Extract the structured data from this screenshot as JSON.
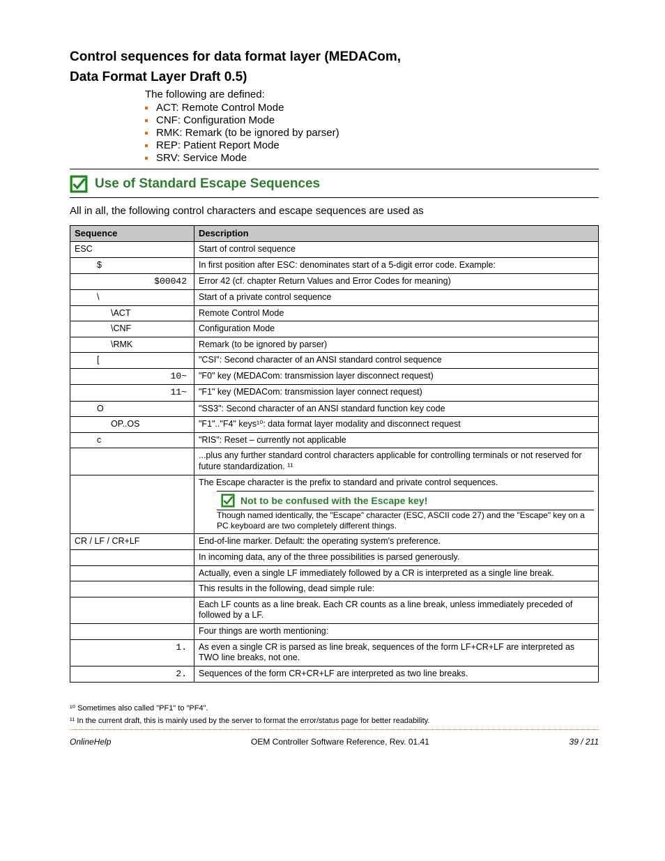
{
  "title_line1": "Control sequences for data format layer (MEDACom,",
  "title_line2": "Data Format Layer Draft 0.5)",
  "pre_bullet_text": "The following are defined:",
  "bullets": [
    "ACT: Remote Control Mode",
    "CNF: Configuration Mode",
    "RMK: Remark (to be ignored by parser)",
    "REP: Patient Report Mode",
    "SRV: Service Mode"
  ],
  "heading": "Use of Standard Escape Sequences",
  "intro": "All in all, the following control characters and escape sequences are used as",
  "table": {
    "headers": {
      "seq": "Sequence",
      "desc": "Description"
    },
    "rows": [
      {
        "type": "section",
        "seq": "ESC",
        "desc": "Start of control sequence"
      },
      {
        "type": "sub",
        "seq": "$",
        "desc": "In first position after ESC: denominates start of a 5-digit error code. Example:"
      },
      {
        "type": "sub2",
        "seq": "$00042",
        "desc": "Error 42 (cf. chapter Return Values and Error Codes for meaning)"
      },
      {
        "type": "sub",
        "seq": "\\",
        "desc": "Start of a private control sequence"
      },
      {
        "type": "sub2",
        "seq": "\\ACT",
        "desc": "Remote Control Mode"
      },
      {
        "type": "sub2",
        "seq": "\\CNF",
        "desc": "Configuration Mode"
      },
      {
        "type": "sub2",
        "seq": "\\RMK",
        "desc": "Remark (to be ignored by parser)"
      },
      {
        "type": "sub",
        "seq": "[",
        "desc": "\"CSI\": Second character of an ANSI standard control sequence"
      },
      {
        "type": "sub2",
        "seq": "10~",
        "desc": "\"F0\" key (MEDACom: transmission layer disconnect request)"
      },
      {
        "type": "sub2",
        "seq": "11~",
        "desc": "\"F1\" key (MEDACom: transmission layer connect request)"
      },
      {
        "type": "sub",
        "seq": "O",
        "desc": "\"SS3\": Second character of an ANSI standard function key code"
      },
      {
        "type": "sub2",
        "seq": "OP..OS",
        "desc": "\"F1\"..\"F4\" keys¹⁰: data format layer modality and disconnect request"
      },
      {
        "type": "sub",
        "seq": "c",
        "desc": "\"RIS\": Reset – currently not applicable"
      },
      {
        "type": "sub2",
        "seq": "",
        "desc": "...plus any further standard control characters applicable for controlling terminals or not reserved for future standardization. ¹¹"
      },
      {
        "type": "note",
        "desc_pre": "The Escape character is the prefix to standard and private control sequences.",
        "note_heading": "Not to be confused with the Escape key!",
        "note_body": "Though named identically, the \"Escape\" character (ESC, ASCII code 27) and the \"Escape\" key on a PC keyboard are two completely different things."
      },
      {
        "type": "section",
        "seq": "CR / LF / CR+LF",
        "desc": "End-of-line marker. Default: the operating system's preference."
      },
      {
        "type": "sub",
        "seq": "",
        "desc": "In incoming data, any of the three possibilities is parsed generously."
      },
      {
        "type": "sub2",
        "seq": "",
        "desc": "Actually, even a single LF immediately followed by a CR is interpreted as a single line break."
      },
      {
        "type": "sub2",
        "seq": "",
        "desc": "This results in the following, dead simple rule:"
      },
      {
        "type": "sub",
        "seq": "",
        "desc": "Each LF counts as a line break. Each CR counts as a line break, unless immediately preceded of followed by a LF."
      },
      {
        "type": "sub2",
        "seq": "",
        "desc": "Four things are worth mentioning:"
      },
      {
        "type": "sub2",
        "seq": "1.",
        "desc": "As even a single CR is parsed as line break, sequences of the form LF+CR+LF are interpreted as TWO line breaks, not one."
      },
      {
        "type": "sub2",
        "seq": "2.",
        "desc": "Sequences of the form CR+CR+LF are interpreted as two line breaks."
      }
    ]
  },
  "footnote10": "¹⁰  Sometimes also called \"PF1\" to \"PF4\".",
  "footnote11": "¹¹  In the current draft, this is mainly used by the server to format the error/status page for better readability.",
  "footer": {
    "left": "OnlineHelp",
    "center": "OEM Controller Software Reference, Rev. 01.41",
    "right": "39 / 211"
  }
}
